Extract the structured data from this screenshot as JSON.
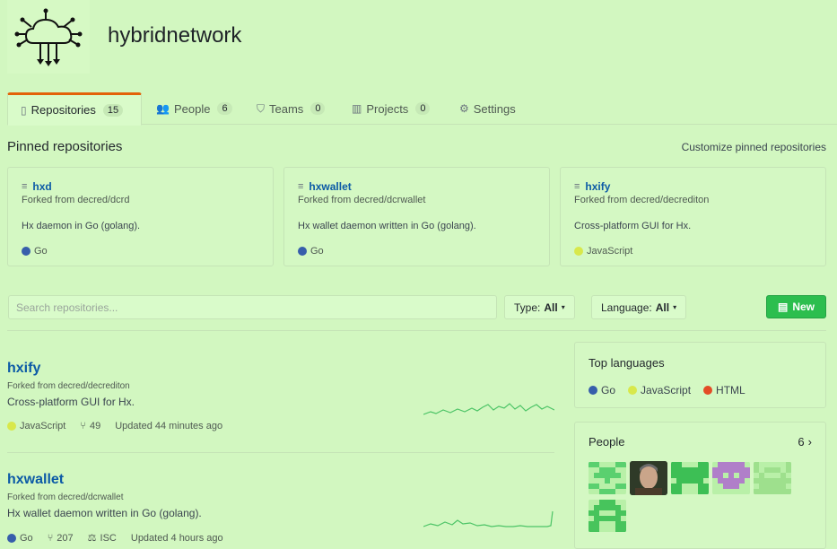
{
  "org": {
    "name": "hybridnetwork",
    "logo_icon": "cloud-network-icon"
  },
  "tabs": [
    {
      "label": "Repositories",
      "count": "15",
      "icon": "repo-icon"
    },
    {
      "label": "People",
      "count": "6",
      "icon": "people-icon"
    },
    {
      "label": "Teams",
      "count": "0",
      "icon": "jersey-icon"
    },
    {
      "label": "Projects",
      "count": "0",
      "icon": "project-icon"
    },
    {
      "label": "Settings",
      "icon": "gear-icon"
    }
  ],
  "pinned": {
    "title": "Pinned repositories",
    "customize_label": "Customize pinned repositories",
    "cards": [
      {
        "name": "hxd",
        "fork": "Forked from decred/dcrd",
        "desc": "Hx daemon in Go (golang).",
        "lang": "Go",
        "lang_color": "#375eab"
      },
      {
        "name": "hxwallet",
        "fork": "Forked from decred/dcrwallet",
        "desc": "Hx wallet daemon written in Go (golang).",
        "lang": "Go",
        "lang_color": "#375eab"
      },
      {
        "name": "hxify",
        "fork": "Forked from decred/decrediton",
        "desc": "Cross-platform GUI for Hx.",
        "lang": "JavaScript",
        "lang_color": "#d8e84b"
      }
    ]
  },
  "filters": {
    "search_placeholder": "Search repositories...",
    "type_label": "Type:",
    "type_value": "All",
    "language_label": "Language:",
    "language_value": "All",
    "new_label": "New"
  },
  "repos": [
    {
      "name": "hxify",
      "fork": "Forked from decred/decrediton",
      "desc": "Cross-platform GUI for Hx.",
      "lang": "JavaScript",
      "lang_color": "#d8e84b",
      "forks": "49",
      "updated": "Updated 44 minutes ago"
    },
    {
      "name": "hxwallet",
      "fork": "Forked from decred/dcrwallet",
      "desc": "Hx wallet daemon written in Go (golang).",
      "lang": "Go",
      "lang_color": "#375eab",
      "forks": "207",
      "license": "ISC",
      "updated": "Updated 4 hours ago"
    }
  ],
  "sidebar": {
    "top_languages_title": "Top languages",
    "languages": [
      {
        "name": "Go",
        "color": "#375eab"
      },
      {
        "name": "JavaScript",
        "color": "#d8e84b"
      },
      {
        "name": "HTML",
        "color": "#e34c26"
      }
    ],
    "people_title": "People",
    "people_count": "6"
  },
  "colors": {
    "accent_tab": "#e36209",
    "link": "#0c5aa6",
    "new_button": "#2cbe4e",
    "background": "#d2f7c0"
  }
}
